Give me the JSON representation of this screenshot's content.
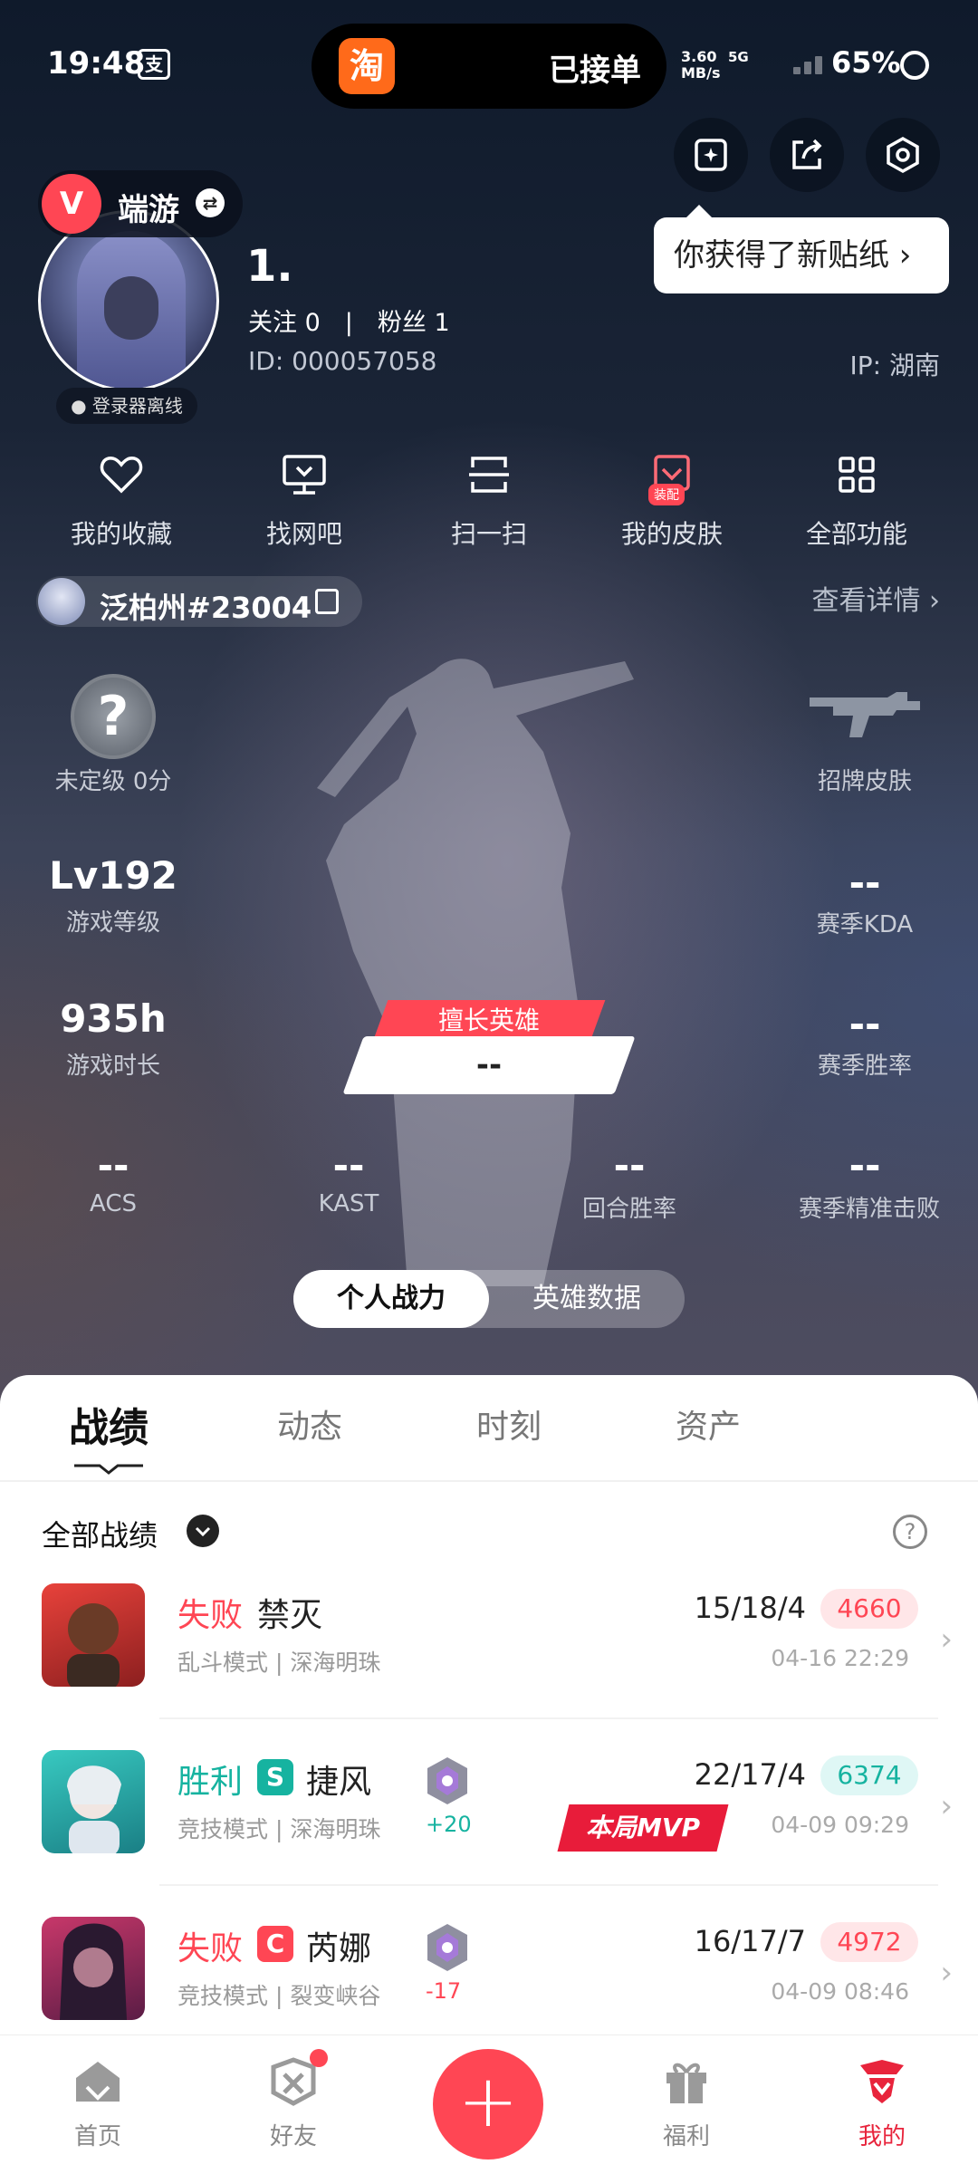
{
  "status_bar": {
    "time": "19:48",
    "pay_icon": "支",
    "island_app_icon": "淘",
    "island_text": "已接单",
    "net_speed": "3.60",
    "net_unit": "MB/s",
    "network": "5G",
    "battery": "65%"
  },
  "top_actions": {
    "tooltip": "你获得了新贴纸 ›"
  },
  "profile": {
    "game_logo": "V",
    "game_name": "端游",
    "online_status": "● 登录器离线",
    "username": "1.",
    "follow_text": "关注 0　|　粉丝 1",
    "id_text": "ID:  000057058",
    "ip_text": "IP:  湖南"
  },
  "quick_menu": [
    {
      "label": "我的收藏",
      "icon": "heart-icon"
    },
    {
      "label": "找网吧",
      "icon": "monitor-icon"
    },
    {
      "label": "扫一扫",
      "icon": "scan-icon"
    },
    {
      "label": "我的皮肤",
      "icon": "skin-icon",
      "badge": "装配"
    },
    {
      "label": "全部功能",
      "icon": "grid-icon"
    }
  ],
  "account": {
    "name": "泛柏州#23004",
    "detail_link": "查看详情 ›"
  },
  "stats": {
    "rank_symbol": "?",
    "rank_label": "未定级 0分",
    "skin_label": "招牌皮肤",
    "level_value": "Lv192",
    "level_label": "游戏等级",
    "kda_value": "--",
    "kda_label": "赛季KDA",
    "hours_value": "935h",
    "hours_label": "游戏时长",
    "winrate_value": "--",
    "winrate_label": "赛季胜率",
    "best_hero_title": "擅长英雄",
    "best_hero_value": "--",
    "acs_value": "--",
    "acs_label": "ACS",
    "kast_value": "--",
    "kast_label": "KAST",
    "round_value": "--",
    "round_label": "回合胜率",
    "precision_value": "--",
    "precision_label": "赛季精准击败"
  },
  "toggle": {
    "active": "个人战力",
    "inactive": "英雄数据"
  },
  "tabs": [
    "战绩",
    "动态",
    "时刻",
    "资产"
  ],
  "filter": {
    "label": "全部战绩",
    "help": "?"
  },
  "matches": [
    {
      "result": "失败",
      "agent": "禁灭",
      "mode": "乱斗模式 | 深海明珠",
      "kda": "15/18/4",
      "score": "4660",
      "time": "04-16 22:29"
    },
    {
      "result": "胜利",
      "badge": "S",
      "agent": "捷风",
      "mode": "竞技模式 | 深海明珠",
      "rank_delta": "+20",
      "mvp": "本局MVP",
      "kda": "22/17/4",
      "score": "6374",
      "time": "04-09 09:29"
    },
    {
      "result": "失败",
      "badge": "C",
      "agent": "芮娜",
      "mode": "竞技模式 | 裂变峡谷",
      "rank_delta": "-17",
      "kda": "16/17/7",
      "score": "4972",
      "time": "04-09 08:46"
    }
  ],
  "colors": {
    "accent": "#ff4654",
    "win": "#16b3a0",
    "lose": "#ff4654"
  },
  "bottom_nav": [
    {
      "label": "首页",
      "icon": "home-icon"
    },
    {
      "label": "好友",
      "icon": "friends-icon"
    },
    {
      "label": "+",
      "icon": "plus-icon"
    },
    {
      "label": "福利",
      "icon": "gift-icon"
    },
    {
      "label": "我的",
      "icon": "me-icon"
    }
  ]
}
